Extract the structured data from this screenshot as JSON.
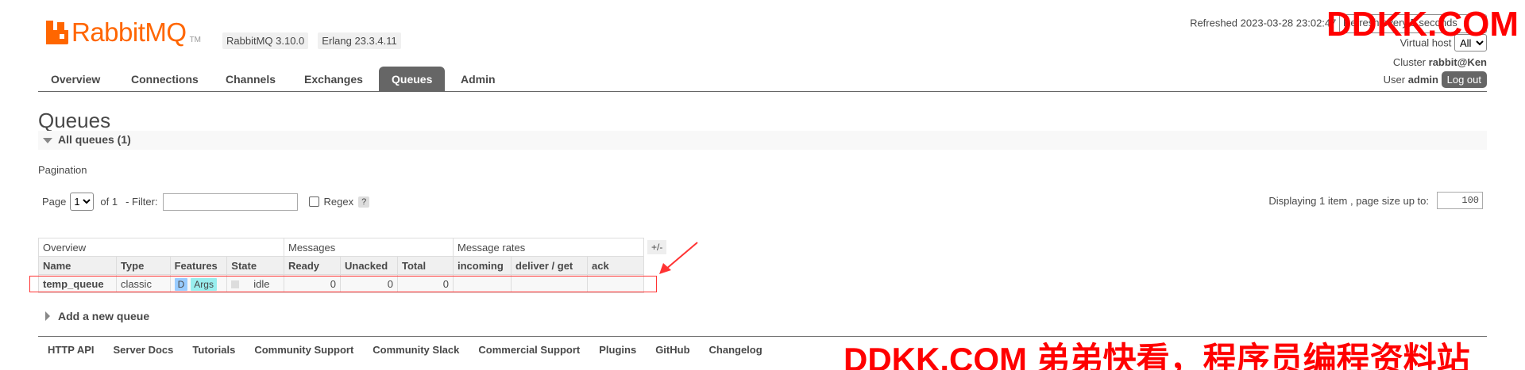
{
  "header": {
    "logo_text": "RabbitMQ",
    "logo_tm": "TM",
    "rabbitmq_version": "RabbitMQ 3.10.0",
    "erlang_version": "Erlang 23.3.4.11",
    "refreshed": "Refreshed 2023-03-28 23:02:47",
    "refresh_select": "Refresh every 5 seconds",
    "virtual_host_label": "Virtual host",
    "virtual_host_value": "All",
    "cluster_label": "Cluster",
    "cluster_value": "rabbit@Ken",
    "user_label": "User",
    "user_value": "admin",
    "logout": "Log out"
  },
  "tabs": [
    {
      "label": "Overview"
    },
    {
      "label": "Connections"
    },
    {
      "label": "Channels"
    },
    {
      "label": "Exchanges"
    },
    {
      "label": "Queues",
      "active": true
    },
    {
      "label": "Admin"
    }
  ],
  "page": {
    "title": "Queues",
    "section": "All queues (1)",
    "pagination_label": "Pagination",
    "page_label": "Page",
    "page_value": "1",
    "of_label": "of 1",
    "filter_label": "- Filter:",
    "regex_label": "Regex",
    "help": "?",
    "displaying": "Displaying 1 item , page size up to:",
    "page_size": "100",
    "plusminus": "+/-",
    "add_new": "Add a new queue"
  },
  "table": {
    "groups": [
      "Overview",
      "Messages",
      "Message rates"
    ],
    "columns": [
      "Name",
      "Type",
      "Features",
      "State",
      "Ready",
      "Unacked",
      "Total",
      "incoming",
      "deliver / get",
      "ack"
    ],
    "rows": [
      {
        "name": "temp_queue",
        "type": "classic",
        "feature1": "D",
        "feature2": "Args",
        "state": "idle",
        "ready": "0",
        "unacked": "0",
        "total": "0"
      }
    ]
  },
  "footer": [
    "HTTP API",
    "Server Docs",
    "Tutorials",
    "Community Support",
    "Community Slack",
    "Commercial Support",
    "Plugins",
    "GitHub",
    "Changelog"
  ],
  "watermarks": {
    "top": "DDKK.COM",
    "bottom": "DDKK.COM 弟弟快看，程序员编程资料站"
  },
  "colors": {
    "brand": "#ff6600",
    "tab_active": "#666666",
    "annotation": "#ff3333"
  }
}
